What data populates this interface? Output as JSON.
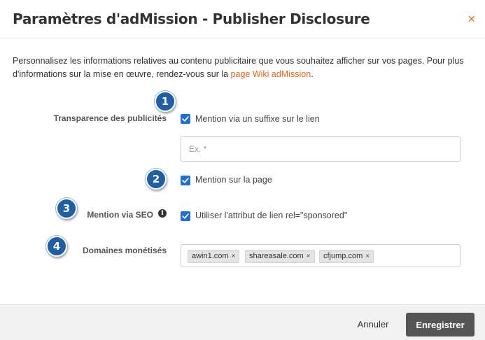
{
  "dialog": {
    "title": "Paramètres d'adMission - Publisher Disclosure",
    "close_glyph": "×"
  },
  "intro": {
    "text": "Personnalisez les informations relatives au contenu publicitaire que vous souhaitez afficher sur vos pages. Pour plus d'informations sur la mise en œuvre, rendez-vous sur la ",
    "link_text": "page Wiki adMission",
    "suffix": "."
  },
  "badges": [
    "1",
    "2",
    "3",
    "4"
  ],
  "transparency": {
    "label": "Transparence des publicités",
    "suffix_checkbox_label": "Mention via un suffixe sur le lien",
    "suffix_checked": true,
    "example_placeholder": "Ex. *",
    "example_value": "",
    "page_checkbox_label": "Mention sur la page",
    "page_checked": true
  },
  "seo": {
    "label": "Mention via SEO",
    "info_glyph": "i",
    "checkbox_label": "Utiliser l'attribut de lien rel=\"sponsored\"",
    "checked": true
  },
  "domains": {
    "label": "Domaines monétisés",
    "tags": [
      "awin1.com",
      "shareasale.com",
      "cfjump.com"
    ],
    "remove_glyph": "×"
  },
  "footer": {
    "cancel_label": "Annuler",
    "save_label": "Enregistrer"
  },
  "colors": {
    "accent": "#e8641b",
    "checkbox": "#1e6fd9",
    "badge": "#1e5fa8",
    "primary_button": "#555555"
  }
}
